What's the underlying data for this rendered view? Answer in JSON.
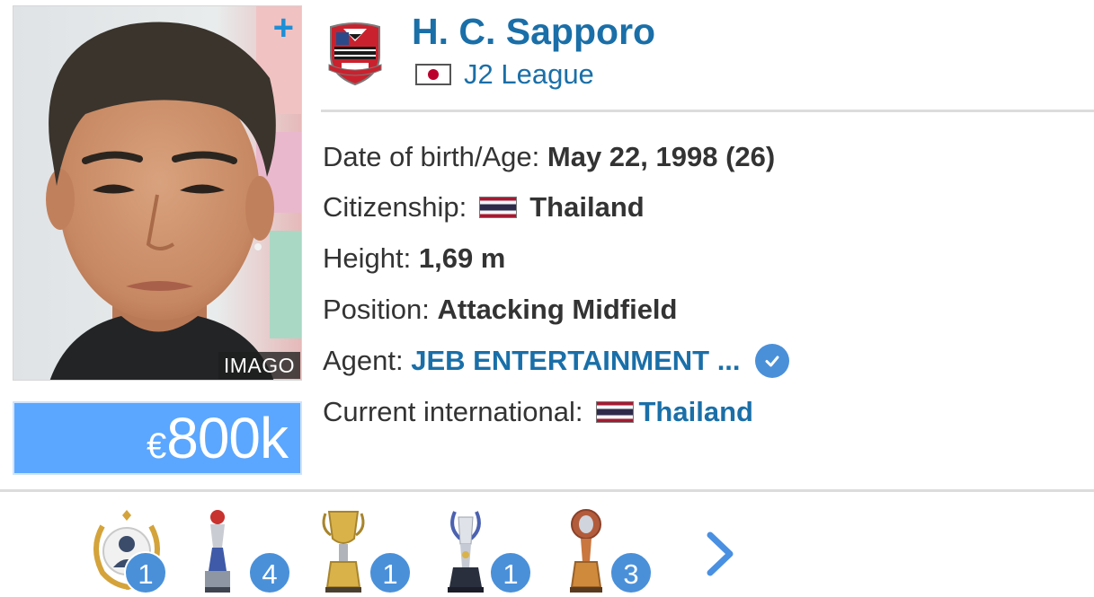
{
  "player": {
    "photo_credit": "IMAGO",
    "add_symbol": "+",
    "market_value": {
      "currency": "€",
      "amount": "800k"
    }
  },
  "club": {
    "name": "H. C. Sapporo",
    "league": "J2 League",
    "league_flag_icon": "japan-flag-icon"
  },
  "info": {
    "dob": {
      "label": "Date of birth/Age:",
      "value": "May 22, 1998 (26)"
    },
    "citizenship": {
      "label": "Citizenship:",
      "value": "Thailand"
    },
    "height": {
      "label": "Height:",
      "value": "1,69 m"
    },
    "position": {
      "label": "Position:",
      "value": "Attacking Midfield"
    },
    "agent": {
      "label": "Agent:",
      "value": "JEB ENTERTAINMENT ...",
      "verified_icon": "verified-check-icon"
    },
    "international": {
      "label": "Current international:",
      "value": "Thailand"
    }
  },
  "trophies": [
    {
      "icon": "player-award-wreath-icon",
      "count": "1"
    },
    {
      "icon": "league-trophy-icon",
      "count": "4"
    },
    {
      "icon": "gold-cup-trophy-icon",
      "count": "1"
    },
    {
      "icon": "champions-trophy-icon",
      "count": "1"
    },
    {
      "icon": "bronze-cup-trophy-icon",
      "count": "3"
    }
  ],
  "colors": {
    "link_blue": "#1a6fa8",
    "market_value_bg": "#5ba7ff",
    "badge_blue": "#4a90d9"
  }
}
